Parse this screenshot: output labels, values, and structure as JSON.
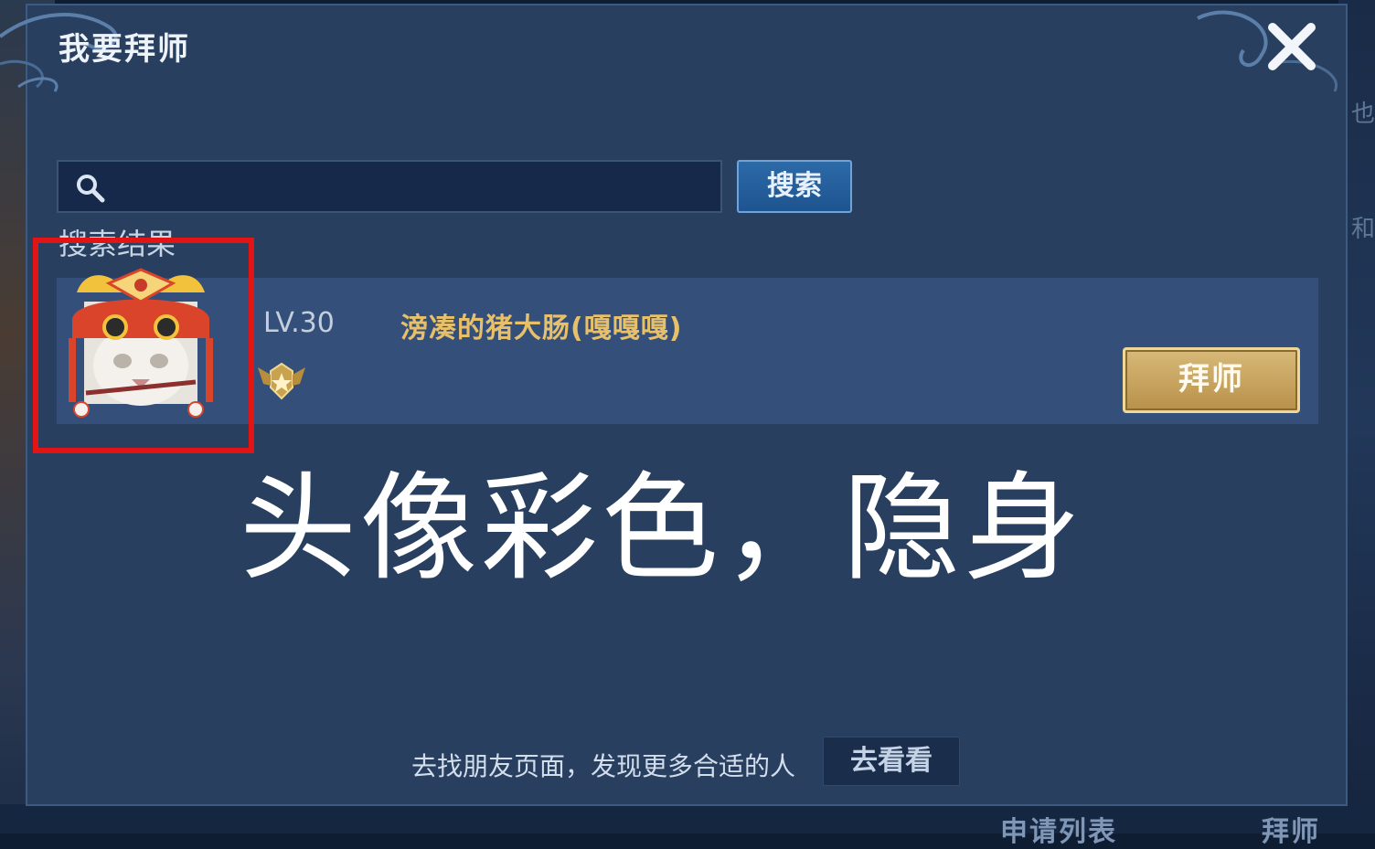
{
  "dialog": {
    "title": "我要拜师",
    "close_icon": "close-icon"
  },
  "search": {
    "placeholder": "",
    "button_label": "搜索",
    "icon": "search-icon"
  },
  "results": {
    "label": "搜索结果",
    "items": [
      {
        "avatar": "avatar-image",
        "level": "LV.30",
        "name": "滂凑的猪大肠(嘎嘎嘎)",
        "rank_icon": "rank-badge-icon",
        "action_label": "拜师"
      }
    ]
  },
  "annotation": {
    "caption": "头像彩色，隐身",
    "highlight_color": "#e31414"
  },
  "footer": {
    "hint_text": "去找朋友页面，发现更多合适的人",
    "button_label": "去看看"
  },
  "background": {
    "right_chars": [
      "也",
      "和"
    ],
    "bottom_tabs": [
      "申请列表",
      "拜师"
    ]
  },
  "colors": {
    "dialog_bg": "#283f60",
    "row_bg": "#34507a",
    "name_gold": "#e9c06a",
    "primary_button": "#2c6aa8",
    "gold_button": "#d8b978"
  }
}
